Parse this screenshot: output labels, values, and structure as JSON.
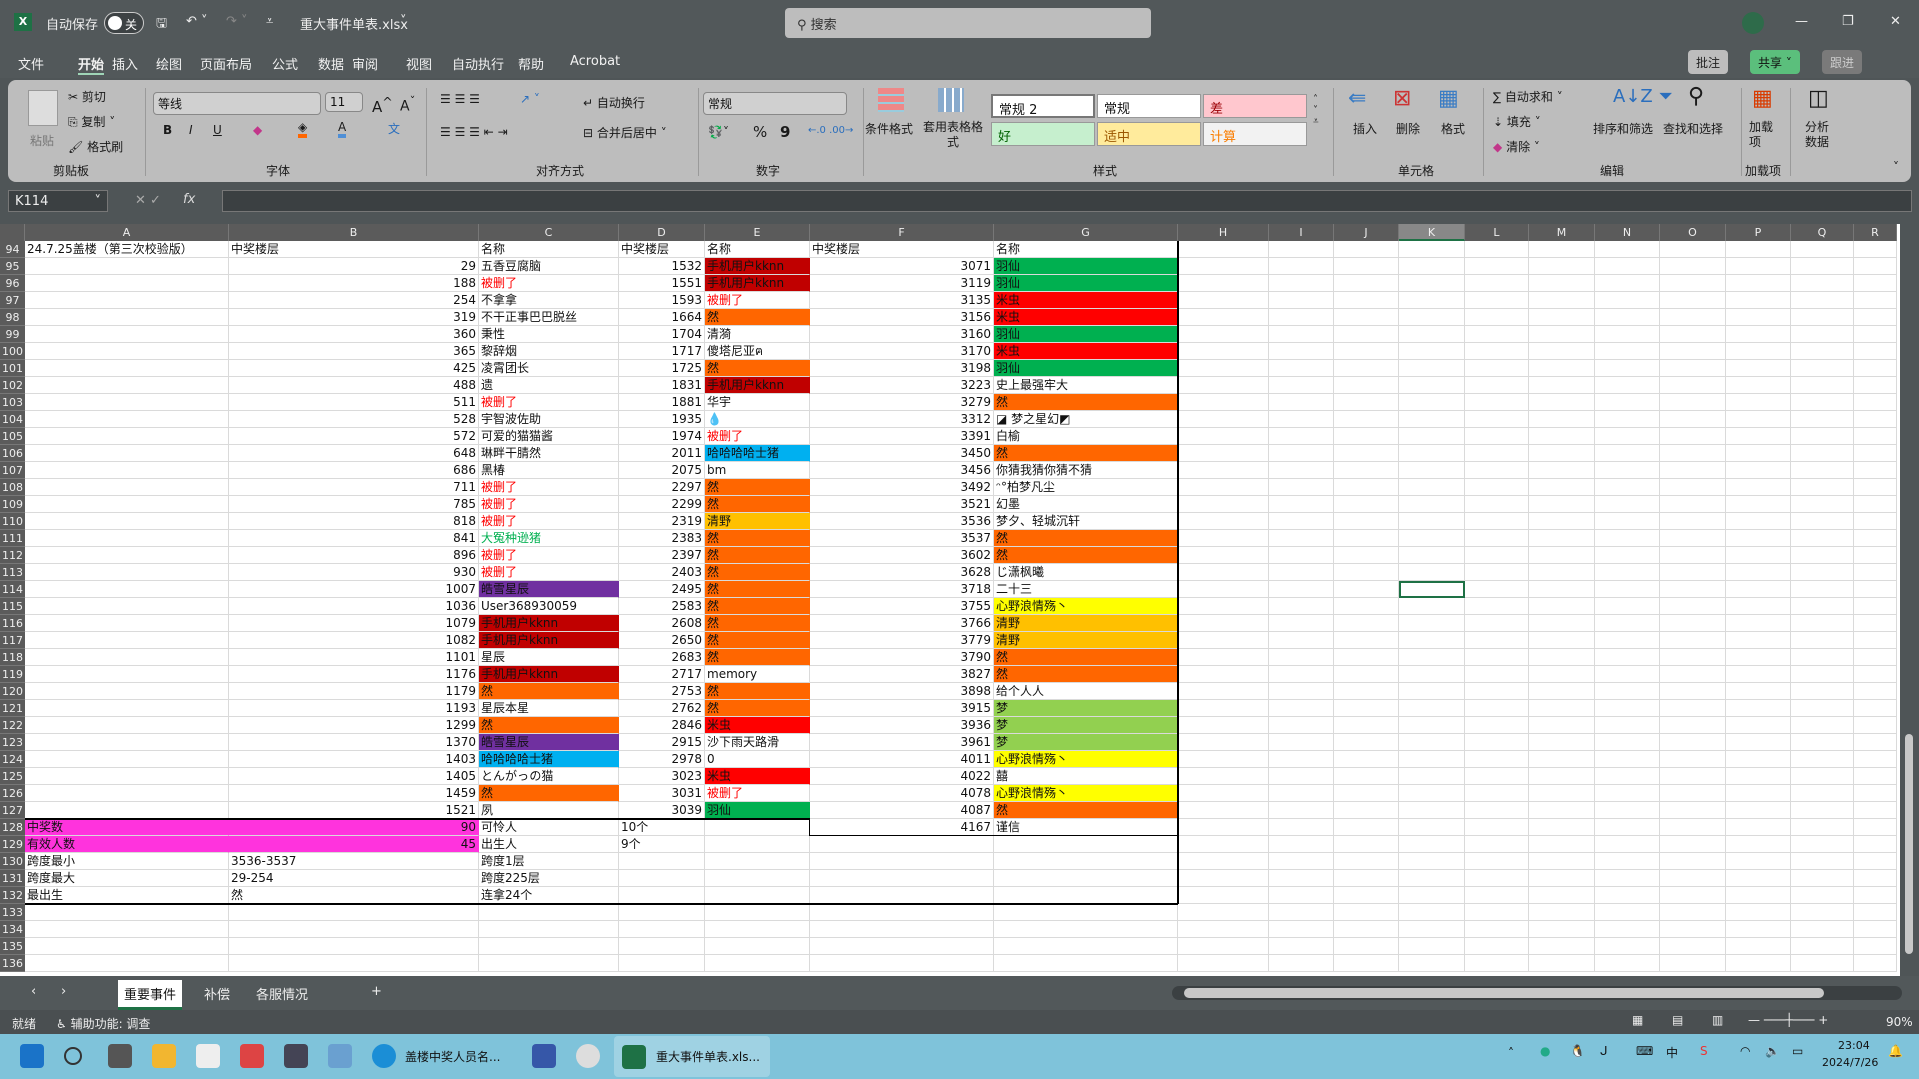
{
  "titlebar": {
    "autosave": "自动保存",
    "toggle": "关",
    "filename": "重大事件单表.xlsx",
    "search_placeholder": "搜索"
  },
  "menu": [
    "文件",
    "开始",
    "插入",
    "绘图",
    "页面布局",
    "公式",
    "数据",
    "审阅",
    "视图",
    "自动执行",
    "帮助",
    "Acrobat"
  ],
  "top_buttons": {
    "comment": "批注",
    "share": "共享",
    "follow": "跟进"
  },
  "ribbon": {
    "clipboard": {
      "paste": "粘贴",
      "cut": "剪切",
      "copy": "复制",
      "format_painter": "格式刷",
      "label": "剪贴板"
    },
    "font": {
      "name": "等线",
      "size": "11",
      "label": "字体",
      "bold": "B",
      "italic": "I",
      "underline": "U"
    },
    "alignment": {
      "wrap": "自动换行",
      "merge": "合并后居中",
      "label": "对齐方式"
    },
    "number": {
      "format": "常规",
      "percent": "%",
      "comma": "9",
      "label": "数字"
    },
    "styles": {
      "conditional": "条件格式",
      "table": "套用表格格式",
      "cells": [
        "常规 2",
        "常规",
        "差",
        "好",
        "适中",
        "计算"
      ],
      "label": "样式"
    },
    "cells": {
      "insert": "插入",
      "delete": "删除",
      "format": "格式",
      "label": "单元格"
    },
    "editing": {
      "autosum": "自动求和",
      "fill": "填充",
      "clear": "清除",
      "sort": "排序和筛选",
      "find": "查找和选择",
      "label": "编辑"
    },
    "addins": {
      "button": "加载项",
      "label": "加载项"
    },
    "analyze": {
      "button": "分析数据"
    }
  },
  "formula": {
    "namebox": "K114",
    "fx": "fx",
    "value": ""
  },
  "selected_cell": "K114",
  "colors": {
    "darkred": "#C00000",
    "orange": "#FF6600",
    "purple": "#7030A0",
    "cyan": "#00B0F0",
    "red": "#FF0000",
    "green": "#00B050",
    "yellow": "#FFFF00",
    "gold": "#FFC000",
    "lightgreen": "#92D050",
    "magenta": "#FF33DD",
    "redtext": "#FF0000",
    "greentext": "#00B050"
  },
  "columns": [
    "A",
    "B",
    "C",
    "D",
    "E",
    "F",
    "G",
    "H",
    "I",
    "J",
    "K",
    "L",
    "M",
    "N",
    "O",
    "P",
    "Q",
    "R"
  ],
  "rows": [
    {
      "n": 94,
      "A": "24.7.25盖楼（第三次校验版）",
      "B": "中奖楼层",
      "C": "名称",
      "D": "中奖楼层",
      "E": "名称",
      "F": "中奖楼层",
      "G": "名称"
    },
    {
      "n": 95,
      "B": "29",
      "C": "五香豆腐脑",
      "D": "1532",
      "E": "手机用户kknn",
      "Ef": "darkred",
      "F": "3071",
      "G": "羽仙",
      "Gf": "green"
    },
    {
      "n": 96,
      "B": "188",
      "C": "被删了",
      "Ct": "redtext",
      "D": "1551",
      "E": "手机用户kknn",
      "Ef": "darkred",
      "F": "3119",
      "G": "羽仙",
      "Gf": "green"
    },
    {
      "n": 97,
      "B": "254",
      "C": "不拿拿",
      "D": "1593",
      "E": "被删了",
      "Et": "redtext",
      "F": "3135",
      "G": "米虫",
      "Gf": "red"
    },
    {
      "n": 98,
      "B": "319",
      "C": "不干正事巴巴脱丝",
      "D": "1664",
      "E": "然",
      "Ef": "orange",
      "F": "3156",
      "G": "米虫",
      "Gf": "red"
    },
    {
      "n": 99,
      "B": "360",
      "C": "秉性",
      "D": "1704",
      "E": "清漪",
      "F": "3160",
      "G": "羽仙",
      "Gf": "green"
    },
    {
      "n": 100,
      "B": "365",
      "C": "黎辞烟",
      "D": "1717",
      "E": "傻塔尼亚ฅ",
      "F": "3170",
      "G": "米虫",
      "Gf": "red"
    },
    {
      "n": 101,
      "B": "425",
      "C": "凌霄团长",
      "D": "1725",
      "E": "然",
      "Ef": "orange",
      "F": "3198",
      "G": "羽仙",
      "Gf": "green"
    },
    {
      "n": 102,
      "B": "488",
      "C": "遗",
      "D": "1831",
      "E": "手机用户kknn",
      "Ef": "darkred",
      "F": "3223",
      "G": "史上最强牢大"
    },
    {
      "n": 103,
      "B": "511",
      "C": "被删了",
      "Ct": "redtext",
      "D": "1881",
      "E": "华宇",
      "F": "3279",
      "G": "然",
      "Gf": "orange"
    },
    {
      "n": 104,
      "B": "528",
      "C": "宇智波佐助",
      "D": "1935",
      "E": "💧",
      "F": "3312",
      "G": "◪ 梦之星幻◩"
    },
    {
      "n": 105,
      "B": "572",
      "C": "可爱的猫猫酱",
      "D": "1974",
      "E": "被删了",
      "Et": "redtext",
      "F": "3391",
      "G": "白榆"
    },
    {
      "n": 106,
      "B": "648",
      "C": "琳畔干腈然",
      "D": "2011",
      "E": "哈哈哈哈士猪",
      "Ef": "cyan",
      "F": "3450",
      "G": "然",
      "Gf": "orange"
    },
    {
      "n": 107,
      "B": "686",
      "C": "黑椿",
      "D": "2075",
      "E": "bm",
      "F": "3456",
      "G": "你猜我猜你猜不猜"
    },
    {
      "n": 108,
      "B": "711",
      "C": "被删了",
      "Ct": "redtext",
      "D": "2297",
      "E": "然",
      "Ef": "orange",
      "F": "3492",
      "G": "ᵔ°柏梦凡尘"
    },
    {
      "n": 109,
      "B": "785",
      "C": "被删了",
      "Ct": "redtext",
      "D": "2299",
      "E": "然",
      "Ef": "orange",
      "F": "3521",
      "G": "幻墨"
    },
    {
      "n": 110,
      "B": "818",
      "C": "被删了",
      "Ct": "redtext",
      "D": "2319",
      "E": "清野",
      "Ef": "gold",
      "F": "3536",
      "G": "梦夕、轻城沉轩"
    },
    {
      "n": 111,
      "B": "841",
      "C": "大冤种逊猪",
      "Ct": "greentext",
      "D": "2383",
      "E": "然",
      "Ef": "orange",
      "F": "3537",
      "G": "然",
      "Gf": "orange"
    },
    {
      "n": 112,
      "B": "896",
      "C": "被删了",
      "Ct": "redtext",
      "D": "2397",
      "E": "然",
      "Ef": "orange",
      "F": "3602",
      "G": "然",
      "Gf": "orange"
    },
    {
      "n": 113,
      "B": "930",
      "C": "被删了",
      "Ct": "redtext",
      "D": "2403",
      "E": "然",
      "Ef": "orange",
      "F": "3628",
      "G": "じ潇枫曦"
    },
    {
      "n": 114,
      "B": "1007",
      "C": "皓雪星辰",
      "Cf": "purple",
      "D": "2495",
      "E": "然",
      "Ef": "orange",
      "F": "3718",
      "G": "二十三"
    },
    {
      "n": 115,
      "B": "1036",
      "C": "User368930059",
      "D": "2583",
      "E": "然",
      "Ef": "orange",
      "F": "3755",
      "G": "心野浪情殇丶",
      "Gf": "yellow"
    },
    {
      "n": 116,
      "B": "1079",
      "C": "手机用户kknn",
      "Cf": "darkred",
      "D": "2608",
      "E": "然",
      "Ef": "orange",
      "F": "3766",
      "G": "清野",
      "Gf": "gold"
    },
    {
      "n": 117,
      "B": "1082",
      "C": "手机用户kknn",
      "Cf": "darkred",
      "D": "2650",
      "E": "然",
      "Ef": "orange",
      "F": "3779",
      "G": "清野",
      "Gf": "gold"
    },
    {
      "n": 118,
      "B": "1101",
      "C": "星辰",
      "D": "2683",
      "E": "然",
      "Ef": "orange",
      "F": "3790",
      "G": "然",
      "Gf": "orange"
    },
    {
      "n": 119,
      "B": "1176",
      "C": "手机用户kknn",
      "Cf": "darkred",
      "D": "2717",
      "E": "memory",
      "F": "3827",
      "G": "然",
      "Gf": "orange"
    },
    {
      "n": 120,
      "B": "1179",
      "C": "然",
      "Cf": "orange",
      "D": "2753",
      "E": "然",
      "Ef": "orange",
      "F": "3898",
      "G": "给个人人"
    },
    {
      "n": 121,
      "B": "1193",
      "C": "星辰本星",
      "D": "2762",
      "E": "然",
      "Ef": "orange",
      "F": "3915",
      "G": "梦",
      "Gf": "lightgreen"
    },
    {
      "n": 122,
      "B": "1299",
      "C": "然",
      "Cf": "orange",
      "D": "2846",
      "E": "米虫",
      "Ef": "red",
      "F": "3936",
      "G": "梦",
      "Gf": "lightgreen"
    },
    {
      "n": 123,
      "B": "1370",
      "C": "皓雪星辰",
      "Cf": "purple",
      "D": "2915",
      "E": "沙下雨天路滑",
      "F": "3961",
      "G": "梦",
      "Gf": "lightgreen"
    },
    {
      "n": 124,
      "B": "1403",
      "C": "哈哈哈哈士猪",
      "Cf": "cyan",
      "D": "2978",
      "E": "0",
      "F": "4011",
      "G": "心野浪情殇丶",
      "Gf": "yellow"
    },
    {
      "n": 125,
      "B": "1405",
      "C": "とんがっの猫",
      "D": "3023",
      "E": "米虫",
      "Ef": "red",
      "F": "4022",
      "G": "囍"
    },
    {
      "n": 126,
      "B": "1459",
      "C": "然",
      "Cf": "orange",
      "D": "3031",
      "E": "被删了",
      "Et": "redtext",
      "F": "4078",
      "G": "心野浪情殇丶",
      "Gf": "yellow"
    },
    {
      "n": 127,
      "B": "1521",
      "C": "夙",
      "D": "3039",
      "E": "羽仙",
      "Ef": "green",
      "F": "4087",
      "G": "然",
      "Gf": "orange"
    },
    {
      "n": 128,
      "A": "中奖数",
      "Af": "magenta",
      "B": "90",
      "Bf": "magenta",
      "C": "可怜人",
      "D": "10个",
      "F": "4167",
      "G": "谨信"
    },
    {
      "n": 129,
      "A": "有效人数",
      "Af": "magenta",
      "B": "45",
      "Bf": "magenta",
      "C": "出生人",
      "D": "9个"
    },
    {
      "n": 130,
      "A": "跨度最小",
      "B": "3536-3537",
      "C": "跨度1层"
    },
    {
      "n": 131,
      "A": "跨度最大",
      "B": "29-254",
      "C": "跨度225层"
    },
    {
      "n": 132,
      "A": "最出生",
      "B": "然",
      "C": "连拿24个"
    },
    {
      "n": 133
    },
    {
      "n": 134
    },
    {
      "n": 135
    },
    {
      "n": 136
    }
  ],
  "sheets": {
    "tabs": [
      "重要事件",
      "补偿",
      "各服情况"
    ],
    "active": "重要事件",
    "add": "+"
  },
  "status": {
    "ready": "就绪",
    "accessibility": "辅助功能: 调查",
    "zoom": "90%"
  },
  "taskbar": {
    "app1": "盖楼中奖人员名...",
    "app2": "重大事件单表.xls...",
    "time": "23:04",
    "date": "2024/7/26"
  }
}
